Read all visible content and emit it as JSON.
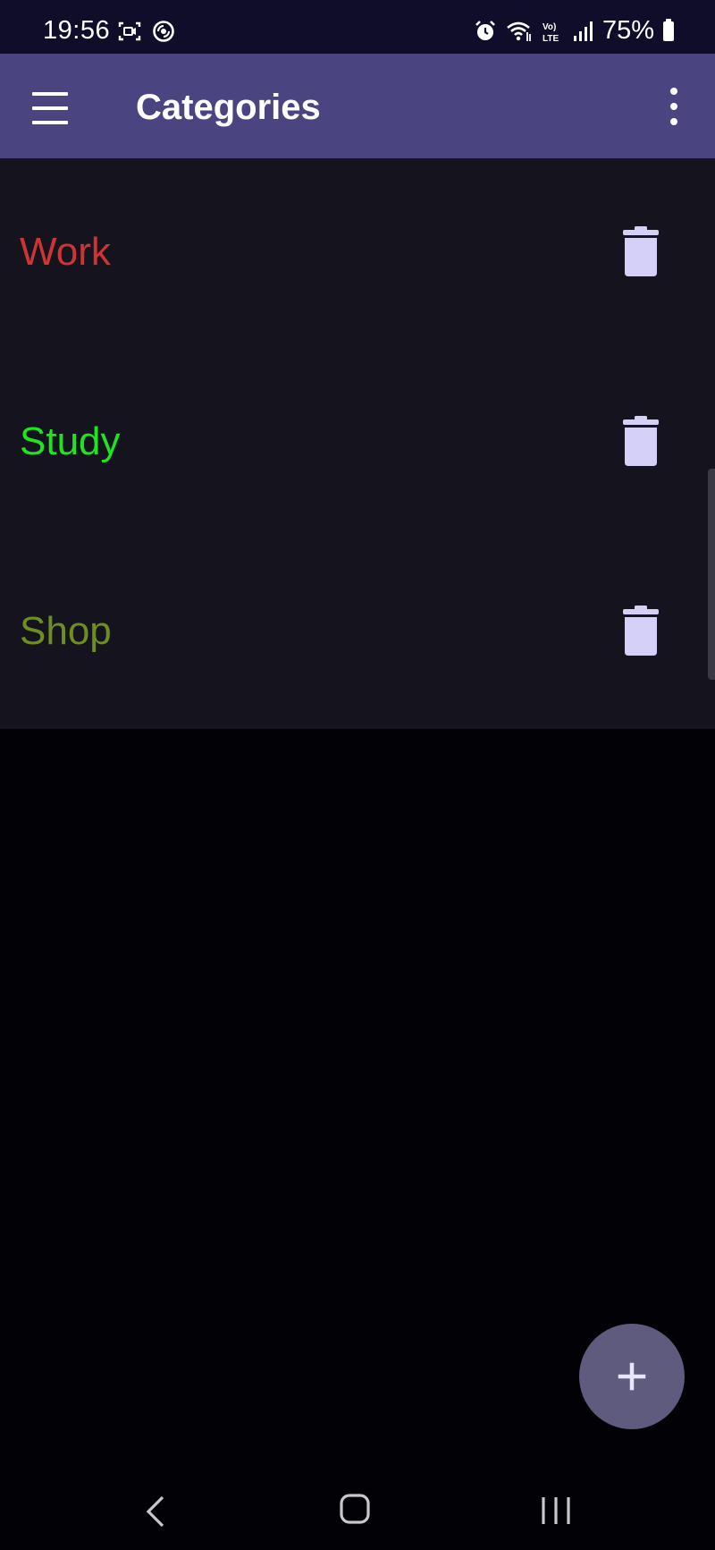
{
  "status_bar": {
    "time": "19:56",
    "battery": "75%",
    "left_icons": [
      "screen-record-icon",
      "sync-icon"
    ],
    "right_icons": [
      "alarm-icon",
      "wifi-icon",
      "volte-icon",
      "signal-icon",
      "battery-icon"
    ]
  },
  "app_bar": {
    "title": "Categories",
    "menu_icon": "hamburger-menu-icon",
    "overflow_icon": "more-vert-icon"
  },
  "categories": [
    {
      "label": "Work",
      "color": "#cf3434",
      "delete_icon": "trash-icon"
    },
    {
      "label": "Study",
      "color": "#1ee61e",
      "delete_icon": "trash-icon"
    },
    {
      "label": "Shop",
      "color": "#6e8f1f",
      "delete_icon": "trash-icon"
    }
  ],
  "fab": {
    "icon": "plus-icon"
  },
  "nav_bar": {
    "back_icon": "back-chevron-icon",
    "home_icon": "home-icon",
    "recents_icon": "recents-icon"
  },
  "colors": {
    "app_bar": "#4a4481",
    "status_bar": "#0f0d2a",
    "list_background": "#15141e",
    "page_background": "#020106",
    "icon_tint": "#d4d0f8",
    "fab": "#5e5b7e"
  }
}
